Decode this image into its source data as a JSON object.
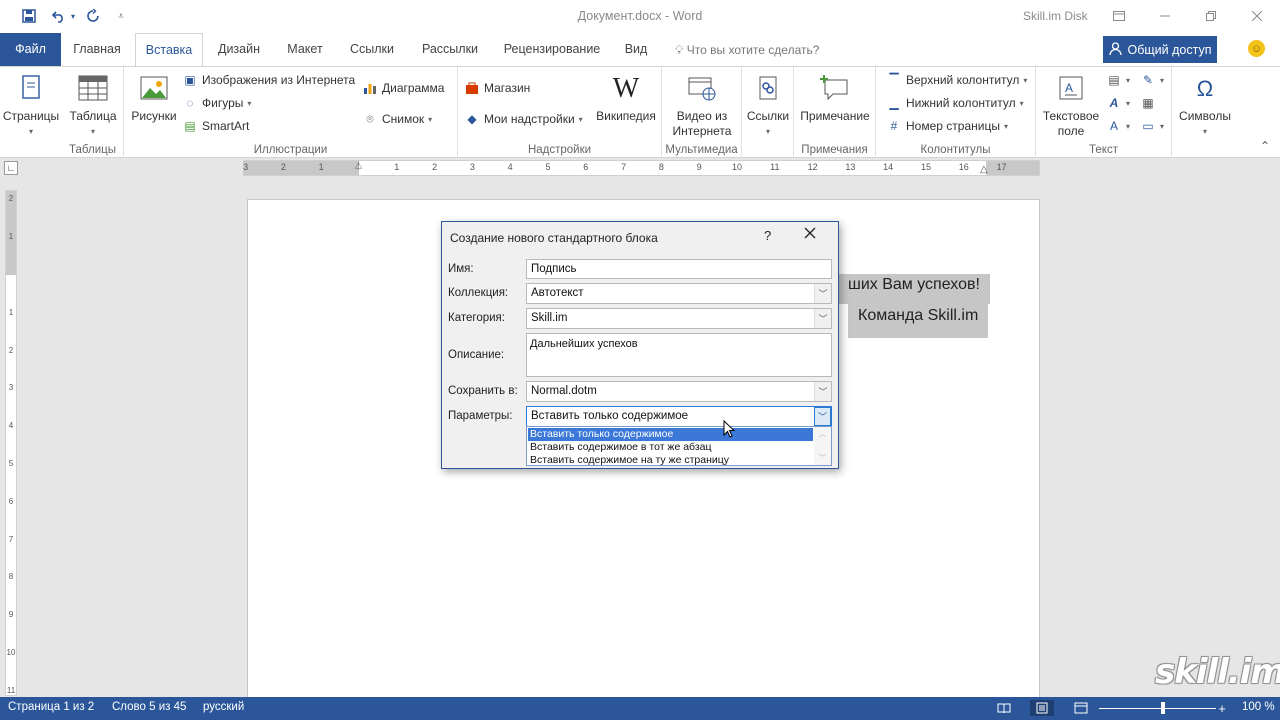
{
  "app": {
    "title": "Документ.docx  -  Word",
    "account": "Skill.im Disk",
    "share_label": "Общий доступ",
    "colors": {
      "accent": "#2b579a",
      "selection": "#3b78d8"
    }
  },
  "tabs": [
    {
      "label": "Файл"
    },
    {
      "label": "Главная"
    },
    {
      "label": "Вставка"
    },
    {
      "label": "Дизайн"
    },
    {
      "label": "Макет"
    },
    {
      "label": "Ссылки"
    },
    {
      "label": "Рассылки"
    },
    {
      "label": "Рецензирование"
    },
    {
      "label": "Вид"
    }
  ],
  "tell_me": "Что вы хотите сделать?",
  "ribbon": {
    "pages": {
      "label": "Страницы"
    },
    "tables": {
      "button": "Таблица",
      "group": "Таблицы"
    },
    "illustrations": {
      "pictures": "Рисунки",
      "online_pictures": "Изображения из Интернета",
      "shapes": "Фигуры",
      "smartart": "SmartArt",
      "chart": "Диаграмма",
      "screenshot": "Снимок",
      "group": "Иллюстрации"
    },
    "addins": {
      "store": "Магазин",
      "my_addins": "Мои надстройки",
      "wikipedia": "Википедия",
      "group": "Надстройки"
    },
    "media": {
      "video_line1": "Видео из",
      "video_line2": "Интернета",
      "group": "Мультимедиа"
    },
    "links": {
      "label": "Ссылки"
    },
    "comments": {
      "label": "Примечание",
      "group": "Примечания"
    },
    "header_footer": {
      "header": "Верхний колонтитул",
      "footer": "Нижний колонтитул",
      "page_number": "Номер страницы",
      "group": "Колонтитулы"
    },
    "text": {
      "textbox_line1": "Текстовое",
      "textbox_line2": "поле",
      "group": "Текст"
    },
    "symbols": {
      "label": "Символы"
    }
  },
  "ruler": {
    "h_numbers": [
      "3",
      "2",
      "1",
      "1",
      "2",
      "3",
      "4",
      "5",
      "6",
      "7",
      "8",
      "9",
      "10",
      "11",
      "12",
      "13",
      "14",
      "15",
      "16",
      "17"
    ],
    "v_numbers": [
      "2",
      "1",
      "1",
      "2",
      "3",
      "4",
      "5",
      "6",
      "7",
      "8",
      "9",
      "10",
      "11"
    ]
  },
  "document": {
    "line1": "ших Вам успехов!",
    "line2": "Команда Skill.im"
  },
  "dialog": {
    "title": "Создание нового стандартного блока",
    "help": "?",
    "name_label": "Имя:",
    "name_value": "Подпись",
    "gallery_label": "Коллекция:",
    "gallery_value": "Автотекст",
    "category_label": "Категория:",
    "category_value": "Skill.im",
    "description_label": "Описание:",
    "description_value": "Дальнейших успехов",
    "save_in_label": "Сохранить в:",
    "save_in_value": "Normal.dotm",
    "options_label": "Параметры:",
    "options_value": "Вставить только содержимое",
    "options_list": [
      "Вставить только содержимое",
      "Вставить содержимое в тот же абзац",
      "Вставить содержимое на ту же страницу"
    ]
  },
  "status": {
    "page": "Страница 1 из 2",
    "words": "Слово 5 из 45",
    "language": "русский",
    "zoom": "100 %"
  },
  "watermark": "skill.im"
}
